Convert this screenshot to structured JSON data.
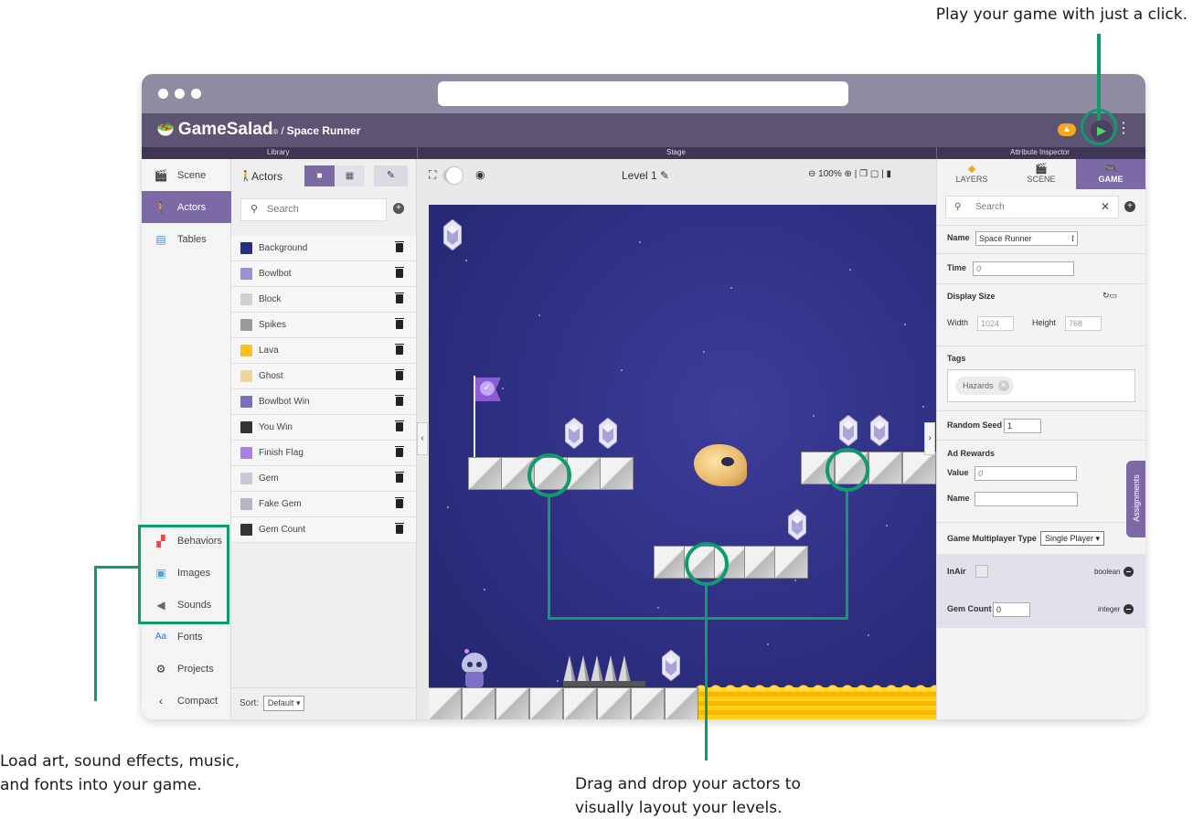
{
  "annotations": {
    "top_right": "Play your game with just a click.",
    "left_line1": "Load art, sound effects, music,",
    "left_line2": "and fonts into your game.",
    "bottom_line1": "Drag and drop your actors to",
    "bottom_line2": "visually layout your levels."
  },
  "app": {
    "name": "GameSalad",
    "trademark": "®",
    "separator": "/",
    "project": "Space Runner"
  },
  "sections": {
    "library": "Library",
    "stage": "Stage",
    "inspector": "Attribute Inspector"
  },
  "nav": {
    "top": [
      {
        "label": "Scene",
        "icon": "clapperboard-icon"
      },
      {
        "label": "Actors",
        "icon": "person-icon"
      },
      {
        "label": "Tables",
        "icon": "table-icon"
      }
    ],
    "bottom": [
      {
        "label": "Behaviors",
        "icon": "behaviors-icon"
      },
      {
        "label": "Images",
        "icon": "image-icon"
      },
      {
        "label": "Sounds",
        "icon": "speaker-icon"
      },
      {
        "label": "Fonts",
        "icon": "fonts-icon"
      },
      {
        "label": "Projects",
        "icon": "gear-icon"
      },
      {
        "label": "Compact",
        "icon": "chevron-left-icon"
      }
    ]
  },
  "library": {
    "title": "Actors",
    "search_placeholder": "Search",
    "sort_label": "Sort:",
    "sort_value": "Default",
    "actors": [
      {
        "name": "Background",
        "color": "#2b2d80"
      },
      {
        "name": "Bowlbot",
        "color": "#9b8fd6"
      },
      {
        "name": "Block",
        "color": "#d0d0d0"
      },
      {
        "name": "Spikes",
        "color": "#9a9a9a"
      },
      {
        "name": "Lava",
        "color": "#ffc01a"
      },
      {
        "name": "Ghost",
        "color": "#f0d49a"
      },
      {
        "name": "Bowlbot Win",
        "color": "#7b6fc0"
      },
      {
        "name": "You Win",
        "color": "#333333"
      },
      {
        "name": "Finish Flag",
        "color": "#a780e8"
      },
      {
        "name": "Gem",
        "color": "#c9c9d6"
      },
      {
        "name": "Fake Gem",
        "color": "#b5b5c6"
      },
      {
        "name": "Gem Count",
        "color": "#333333"
      }
    ]
  },
  "stage": {
    "level": "Level 1",
    "zoom": "100%"
  },
  "inspector": {
    "tabs": [
      "LAYERS",
      "SCENE",
      "GAME"
    ],
    "active_tab": "GAME",
    "search_placeholder": "Search",
    "name_label": "Name",
    "name_value": "Space Runner",
    "time_label": "Time",
    "time_value": "0",
    "display_size_label": "Display Size",
    "width_label": "Width",
    "width_value": "1024",
    "height_label": "Height",
    "height_value": "768",
    "tags_label": "Tags",
    "tag": "Hazards",
    "random_seed_label": "Random Seed",
    "random_seed_value": "1",
    "ad_rewards_label": "Ad Rewards",
    "value_label": "Value",
    "value_value": "0",
    "ad_name_label": "Name",
    "multiplayer_label": "Game Multiplayer Type",
    "multiplayer_value": "Single Player",
    "attrs": [
      {
        "name": "InAir",
        "type": "boolean"
      },
      {
        "name": "Gem Count",
        "value": "0",
        "type": "integer"
      }
    ],
    "assignments_label": "Assignments"
  },
  "colors": {
    "accent": "#7b6aa5",
    "appbar": "#5d5474",
    "callout": "#0f9b6e",
    "play": "#4cd964"
  }
}
